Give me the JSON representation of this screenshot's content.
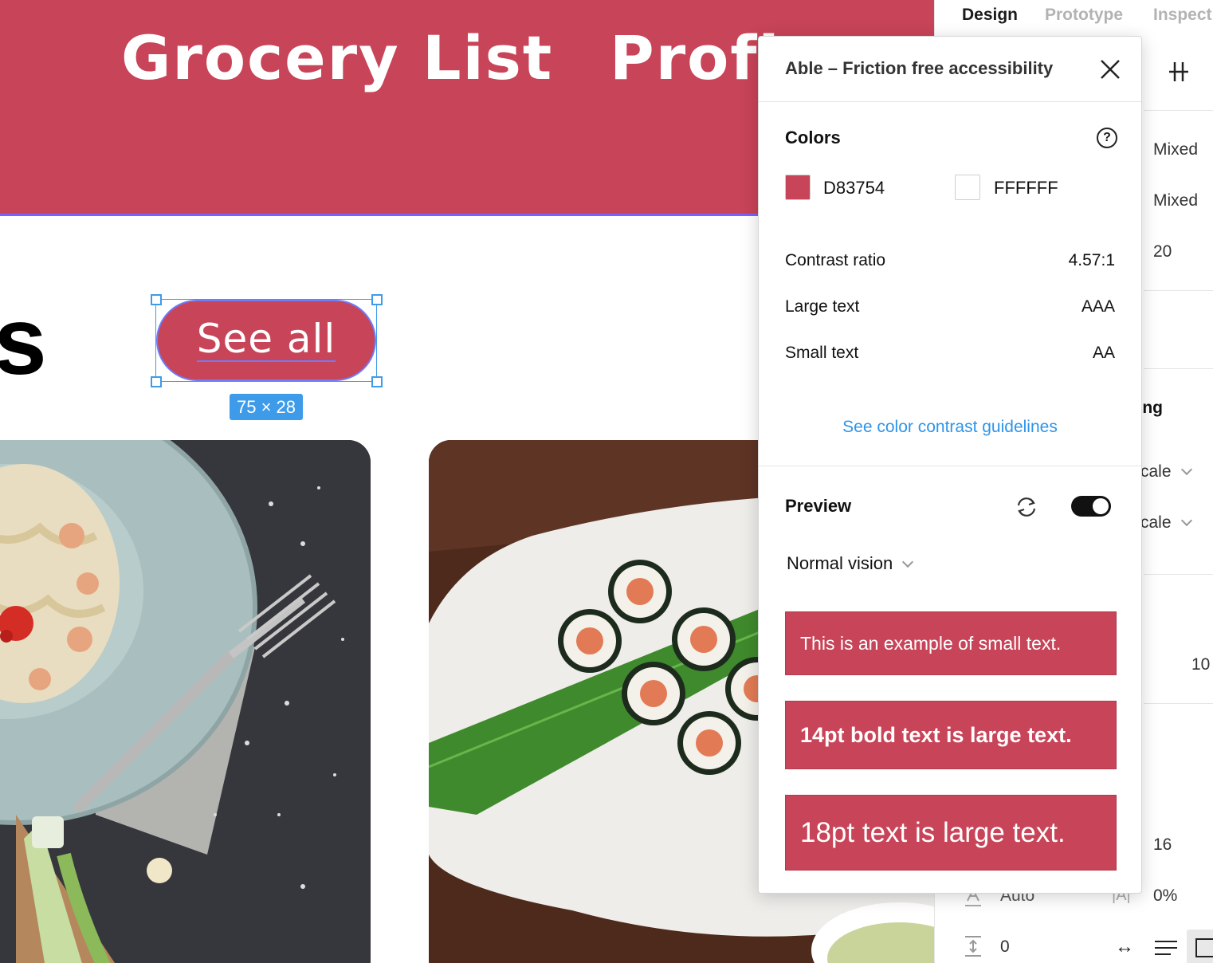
{
  "canvas": {
    "hero": {
      "title_1": "Grocery List",
      "title_2": "Profi",
      "background": "#C84458"
    },
    "heading_fragment": "s",
    "see_all_button": {
      "label": "See all"
    },
    "selection_badge": "75 × 28",
    "cards": [
      {
        "name": "pasta"
      },
      {
        "name": "sushi"
      }
    ]
  },
  "right_panel": {
    "tabs": {
      "design": "Design",
      "prototype": "Prototype",
      "inspect": "Inspect"
    },
    "values": {
      "mixed_1": "Mixed",
      "mixed_2": "Mixed",
      "twenty": "20",
      "section_fragment": "zing",
      "scale_1": "cale",
      "scale_2": "cale",
      "hundred": "10",
      "sixteen": "16",
      "auto": "Auto",
      "percent": "0%",
      "zero": "0"
    }
  },
  "plugin": {
    "title": "Able – Friction free accessibility",
    "colors": {
      "heading": "Colors",
      "foreground_hex": "D83754",
      "foreground_color": "#C84458",
      "background_hex": "FFFFFF",
      "background_color": "#FFFFFF"
    },
    "contrast": {
      "ratio_label": "Contrast ratio",
      "ratio_value": "4.57:1",
      "large_label": "Large text",
      "large_value": "AAA",
      "small_label": "Small text",
      "small_value": "AA"
    },
    "guidelines_link": "See color contrast guidelines",
    "preview": {
      "heading": "Preview",
      "toggle_on": true,
      "vision_mode": "Normal vision",
      "samples": {
        "small": "This is an example of small text.",
        "bold": "14pt bold text is large text.",
        "large": "18pt text is large text."
      }
    }
  }
}
